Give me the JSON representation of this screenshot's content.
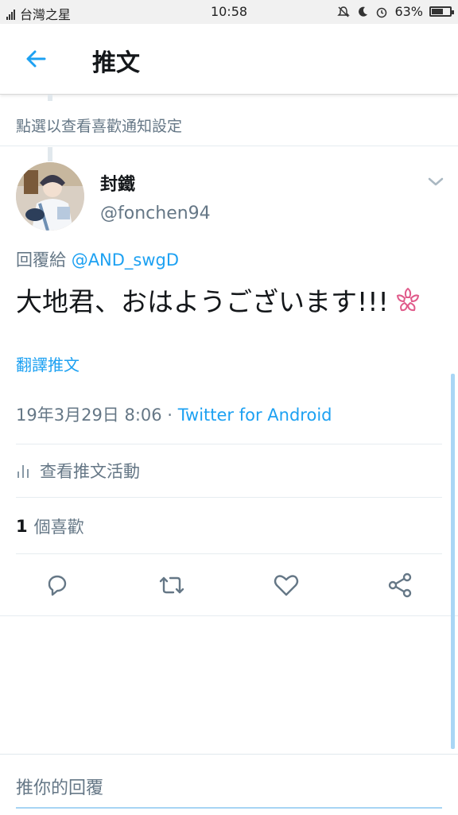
{
  "status_bar": {
    "carrier": "台灣之星",
    "time": "10:58",
    "battery": "63%",
    "battery_level": 0.63
  },
  "header": {
    "title": "推文"
  },
  "notice": "點選以查看喜歡通知設定",
  "tweet": {
    "display_name": "封鐵",
    "handle": "@fonchen94",
    "reply_prefix": "回覆給",
    "reply_mention": "@AND_swgD",
    "text": "大地君、おはようございます!!!",
    "translate_label": "翻譯推文",
    "timestamp": "19年3月29日 8:06 ·",
    "via": "Twitter for Android",
    "activity_label": "查看推文活動",
    "likes_count": "1",
    "likes_label": "個喜歡"
  },
  "composer": {
    "placeholder": "推你的回覆"
  },
  "colors": {
    "accent": "#1da1f2",
    "muted": "#657786",
    "text": "#14171a",
    "emoji_flower": "#e05a8a"
  },
  "icons": {
    "back": "arrow-left-icon",
    "caret": "chevron-down-icon",
    "activity": "bar-chart-icon",
    "reply": "comment-icon",
    "retweet": "retweet-icon",
    "like": "heart-icon",
    "share": "share-icon",
    "flower": "cherry-blossom-icon"
  }
}
